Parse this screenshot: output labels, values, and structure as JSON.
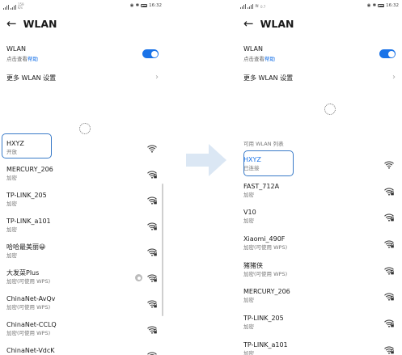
{
  "status_bar": {
    "left_tiny_a": "159",
    "left_tiny_b": "K/s",
    "left_tiny_c": "0.7",
    "time": "16:32"
  },
  "left_screen": {
    "title": "WLAN",
    "wlan_label": "WLAN",
    "wlan_help_prefix": "点击查看",
    "wlan_help_link": "帮助",
    "more_settings": "更多 WLAN 设置",
    "networks": [
      {
        "name": "HXYZ",
        "status": "开放",
        "secured": false,
        "wps": false
      },
      {
        "name": "MERCURY_206",
        "status": "加密",
        "secured": true,
        "wps": false
      },
      {
        "name": "TP-LINK_205",
        "status": "加密",
        "secured": true,
        "wps": false
      },
      {
        "name": "TP-LINK_a101",
        "status": "加密",
        "secured": true,
        "wps": false
      },
      {
        "name": "哈哈最美丽😀",
        "status": "加密",
        "secured": true,
        "wps": false
      },
      {
        "name": "大发菜Plus",
        "status": "加密(可使用 WPS)",
        "secured": true,
        "wps": true
      },
      {
        "name": "ChinaNet-AvQv",
        "status": "加密(可使用 WPS)",
        "secured": true,
        "wps": false
      },
      {
        "name": "ChinaNet-CCLQ",
        "status": "加密(可使用 WPS)",
        "secured": true,
        "wps": false
      },
      {
        "name": "ChinaNet-VdcK",
        "status": "",
        "secured": true,
        "wps": false
      }
    ]
  },
  "right_screen": {
    "title": "WLAN",
    "wlan_label": "WLAN",
    "wlan_help_prefix": "点击查看",
    "wlan_help_link": "帮助",
    "more_settings": "更多 WLAN 设置",
    "section_label": "可用 WLAN 列表",
    "networks": [
      {
        "name": "HXYZ",
        "status": "已连接",
        "connected": true,
        "secured": false
      },
      {
        "name": "FAST_712A",
        "status": "加密",
        "secured": true
      },
      {
        "name": "V10",
        "status": "加密",
        "secured": true
      },
      {
        "name": "Xiaomi_490F",
        "status": "加密(可使用 WPS)",
        "secured": true
      },
      {
        "name": "猪猪侠",
        "status": "加密(可使用 WPS)",
        "secured": true
      },
      {
        "name": "MERCURY_206",
        "status": "加密",
        "secured": true
      },
      {
        "name": "TP-LINK_205",
        "status": "加密",
        "secured": true
      },
      {
        "name": "TP-LINK_a101",
        "status": "加密",
        "secured": true
      }
    ]
  },
  "colors": {
    "accent": "#1a73e8",
    "highlight_border": "#3a7bc8",
    "arrow": "#dbe7f4"
  }
}
